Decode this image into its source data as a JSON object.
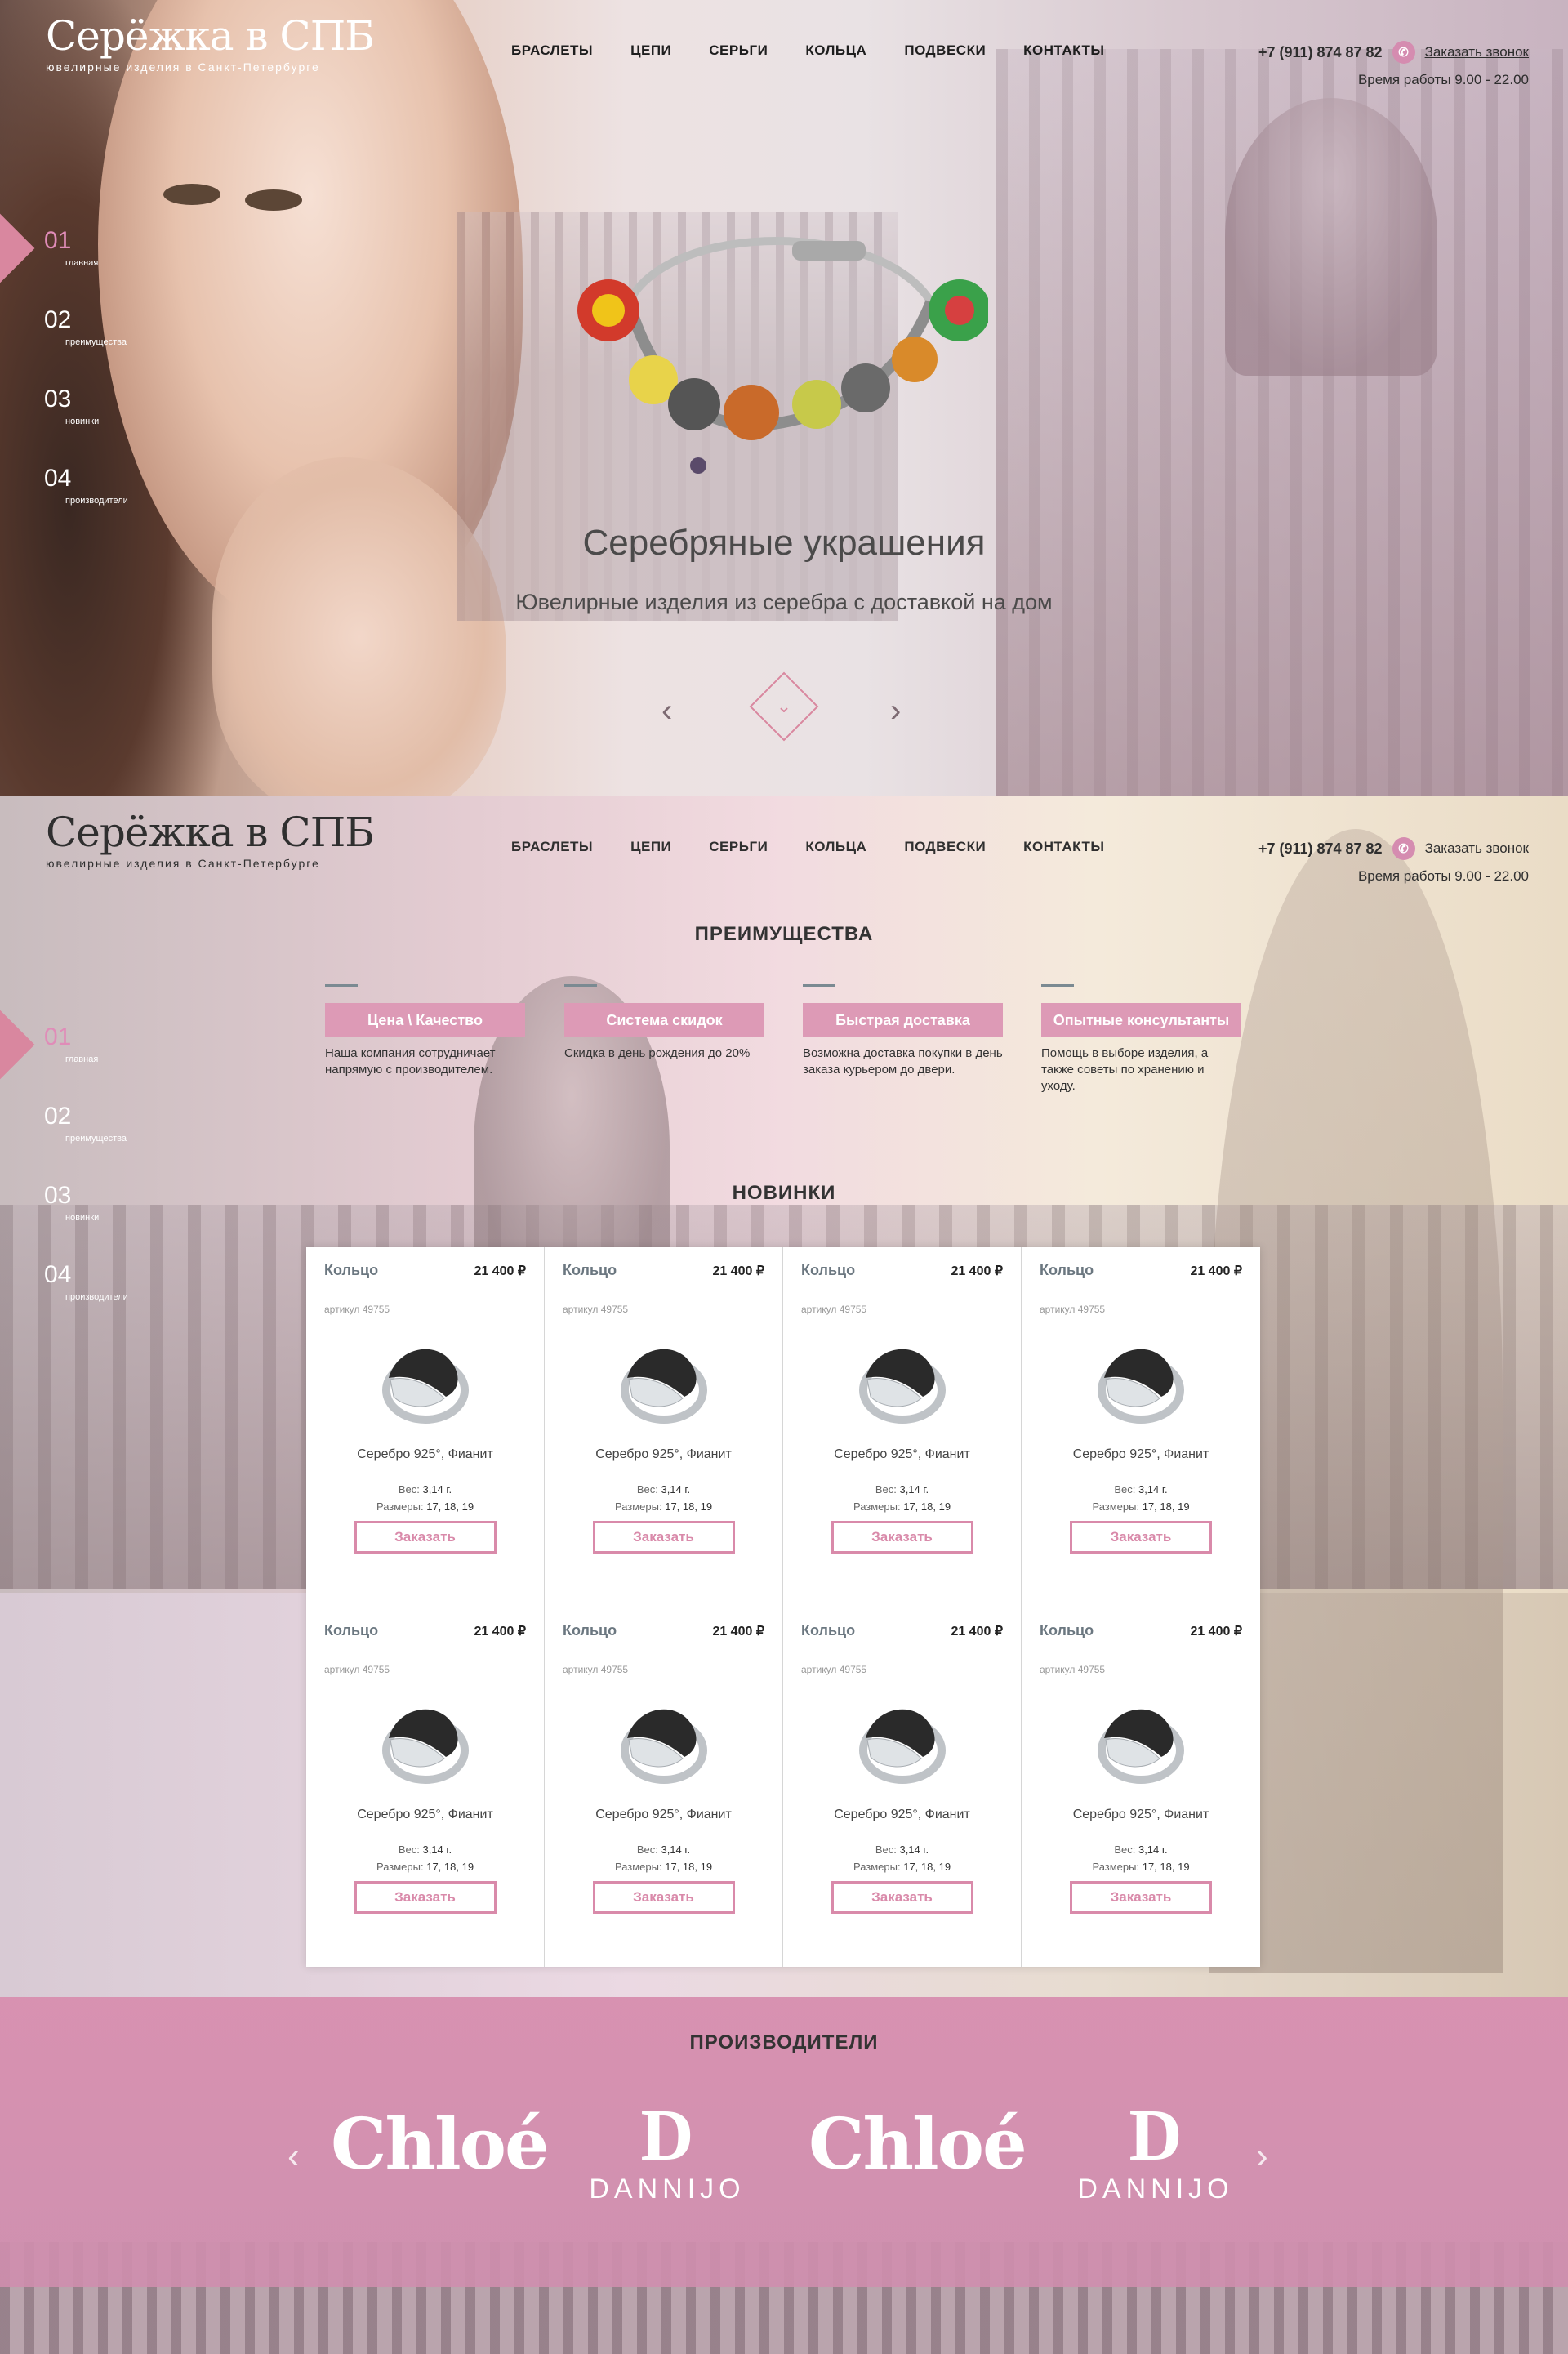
{
  "header": {
    "logo_title": "Серёжка в СПБ",
    "logo_sub": "ювелирные изделия в Санкт-Петербурге",
    "nav": [
      "БРАСЛЕТЫ",
      "ЦЕПИ",
      "СЕРЬГИ",
      "КОЛЬЦА",
      "ПОДВЕСКИ",
      "КОНТАКТЫ"
    ],
    "phone": "+7 (911) 874 87 82",
    "call_label": "Заказать звонок",
    "hours": "Время работы 9.00 - 22.00"
  },
  "dots": [
    {
      "num": "01",
      "label": "главная"
    },
    {
      "num": "02",
      "label": "преимущества"
    },
    {
      "num": "03",
      "label": "новинки"
    },
    {
      "num": "04",
      "label": "производители"
    }
  ],
  "hero": {
    "title": "Серебряные украшения",
    "subtitle": "Ювелирные изделия из серебра с доставкой на дом",
    "prev": "‹",
    "next": "›",
    "down": "⌄"
  },
  "advantages": {
    "title": "ПРЕИМУЩЕСТВА",
    "items": [
      {
        "label": "Цена \\ Качество",
        "text": "Наша компания сотрудничает напрямую с производителем.",
        "icon": "scales-icon"
      },
      {
        "label": "Система скидок",
        "text": "Скидка в день рождения до 20%",
        "icon": "percent-icon"
      },
      {
        "label": "Быстрая доставка",
        "text": "Возможна доставка покупки в день заказа курьером до двери.",
        "icon": "truck-icon"
      },
      {
        "label": "Опытные консультанты",
        "text": "Помощь в выборе изделия, а также советы по хранению и уходу.",
        "icon": "consultant-icon"
      }
    ]
  },
  "products": {
    "title": "НОВИНКИ",
    "weight_label": "Вес:",
    "size_label": "Размеры:",
    "items": [
      {
        "name": "Кольцо",
        "price": "21 400 ₽",
        "article": "артикул 49755",
        "material": "Серебро 925°, Фианит",
        "weight": "3,14 г.",
        "sizes": "17, 18, 19",
        "button": "Заказать"
      },
      {
        "name": "Кольцо",
        "price": "21 400 ₽",
        "article": "артикул 49755",
        "material": "Серебро 925°, Фианит",
        "weight": "3,14 г.",
        "sizes": "17, 18, 19",
        "button": "Заказать"
      },
      {
        "name": "Кольцо",
        "price": "21 400 ₽",
        "article": "артикул 49755",
        "material": "Серебро 925°, Фианит",
        "weight": "3,14 г.",
        "sizes": "17, 18, 19",
        "button": "Заказать"
      },
      {
        "name": "Кольцо",
        "price": "21 400 ₽",
        "article": "артикул 49755",
        "material": "Серебро 925°, Фианит",
        "weight": "3,14 г.",
        "sizes": "17, 18, 19",
        "button": "Заказать"
      },
      {
        "name": "Кольцо",
        "price": "21 400 ₽",
        "article": "артикул 49755",
        "material": "Серебро 925°, Фианит",
        "weight": "3,14 г.",
        "sizes": "17, 18, 19",
        "button": "Заказать"
      },
      {
        "name": "Кольцо",
        "price": "21 400 ₽",
        "article": "артикул 49755",
        "material": "Серебро 925°, Фианит",
        "weight": "3,14 г.",
        "sizes": "17, 18, 19",
        "button": "Заказать"
      },
      {
        "name": "Кольцо",
        "price": "21 400 ₽",
        "article": "артикул 49755",
        "material": "Серебро 925°, Фианит",
        "weight": "3,14 г.",
        "sizes": "17, 18, 19",
        "button": "Заказать"
      },
      {
        "name": "Кольцо",
        "price": "21 400 ₽",
        "article": "артикул 49755",
        "material": "Серебро 925°, Фианит",
        "weight": "3,14 г.",
        "sizes": "17, 18, 19",
        "button": "Заказать"
      }
    ]
  },
  "makers": {
    "title": "ПРОИЗВОДИТЕЛИ",
    "brands": [
      {
        "type": "chloe",
        "name": "Chloé"
      },
      {
        "type": "dannijo",
        "mark": "D",
        "name": "DANNIJO"
      },
      {
        "type": "chloe",
        "name": "Chloé"
      },
      {
        "type": "dannijo",
        "mark": "D",
        "name": "DANNIJO"
      }
    ],
    "prev": "‹",
    "next": "›"
  },
  "colors": {
    "accent": "#d9879f",
    "badge": "#dd9ab6",
    "button": "#d98aaa"
  }
}
